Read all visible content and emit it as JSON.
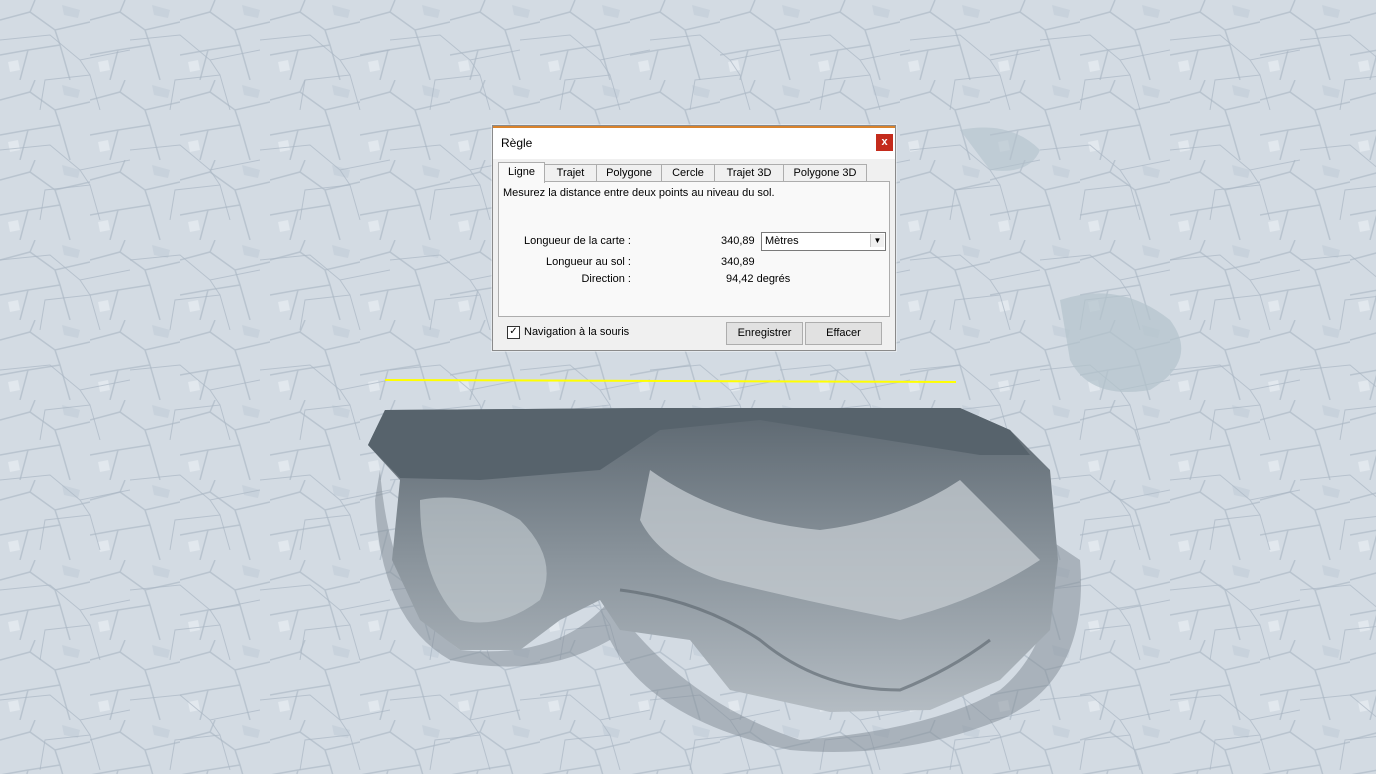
{
  "dialog": {
    "title": "Règle",
    "close_label": "x",
    "tabs": [
      "Ligne",
      "Trajet",
      "Polygone",
      "Cercle",
      "Trajet 3D",
      "Polygone 3D"
    ],
    "description": "Mesurez la distance entre deux points au niveau du sol.",
    "map_length_label": "Longueur de la carte :",
    "map_length_value": "340,89",
    "unit_selected": "Mètres",
    "ground_length_label": "Longueur au sol :",
    "ground_length_value": "340,89",
    "direction_label": "Direction :",
    "direction_value": "94,42 degrés",
    "mouse_nav_label": "Navigation à la souris",
    "mouse_nav_checked": true,
    "save_button": "Enregistrer",
    "clear_button": "Effacer"
  },
  "colors": {
    "measure_line": "#ffff00",
    "close_button": "#c42b1c",
    "title_accent": "#d9822b"
  }
}
